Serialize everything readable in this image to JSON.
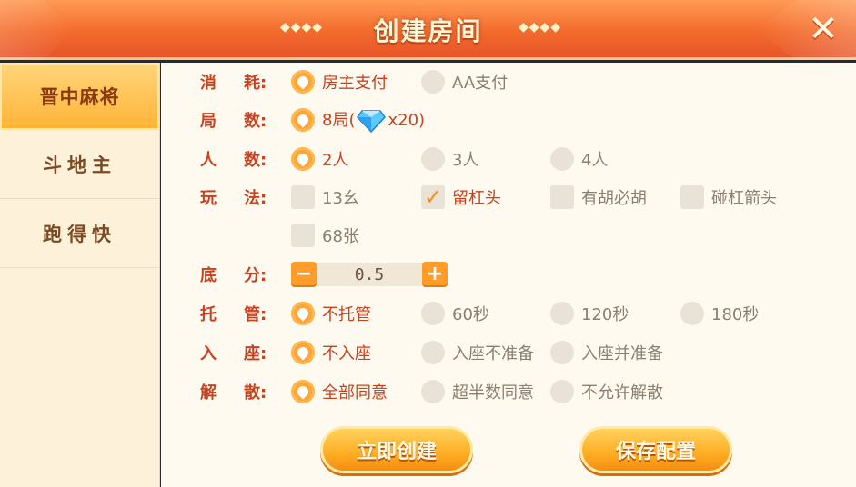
{
  "header": {
    "title": "创建房间",
    "deco": "◆◆◆◆"
  },
  "sidebar": {
    "items": [
      {
        "label": "晋中麻将",
        "active": true
      },
      {
        "label": "斗地主",
        "active": false
      },
      {
        "label": "跑得快",
        "active": false
      }
    ]
  },
  "rows": {
    "consume": {
      "label1": "消",
      "label2": "耗:",
      "options": [
        "房主支付",
        "AA支付"
      ]
    },
    "rounds": {
      "label1": "局",
      "label2": "数:",
      "option_prefix": "8局(",
      "option_suffix": "x20)"
    },
    "players": {
      "label1": "人",
      "label2": "数:",
      "options": [
        "2人",
        "3人",
        "4人"
      ]
    },
    "rules": {
      "label1": "玩",
      "label2": "法:",
      "options": [
        "13幺",
        "留杠头",
        "有胡必胡",
        "碰杠箭头",
        "68张"
      ]
    },
    "base": {
      "label1": "底",
      "label2": "分:",
      "value": "0.5",
      "minus": "−",
      "plus": "+"
    },
    "trustee": {
      "label1": "托",
      "label2": "管:",
      "options": [
        "不托管",
        "60秒",
        "120秒",
        "180秒"
      ]
    },
    "seat": {
      "label1": "入",
      "label2": "座:",
      "options": [
        "不入座",
        "入座不准备",
        "入座并准备"
      ]
    },
    "dismiss": {
      "label1": "解",
      "label2": "散:",
      "options": [
        "全部同意",
        "超半数同意",
        "不允许解散"
      ]
    }
  },
  "buttons": {
    "create": "立即创建",
    "save": "保存配置"
  },
  "close_icon": "✕"
}
